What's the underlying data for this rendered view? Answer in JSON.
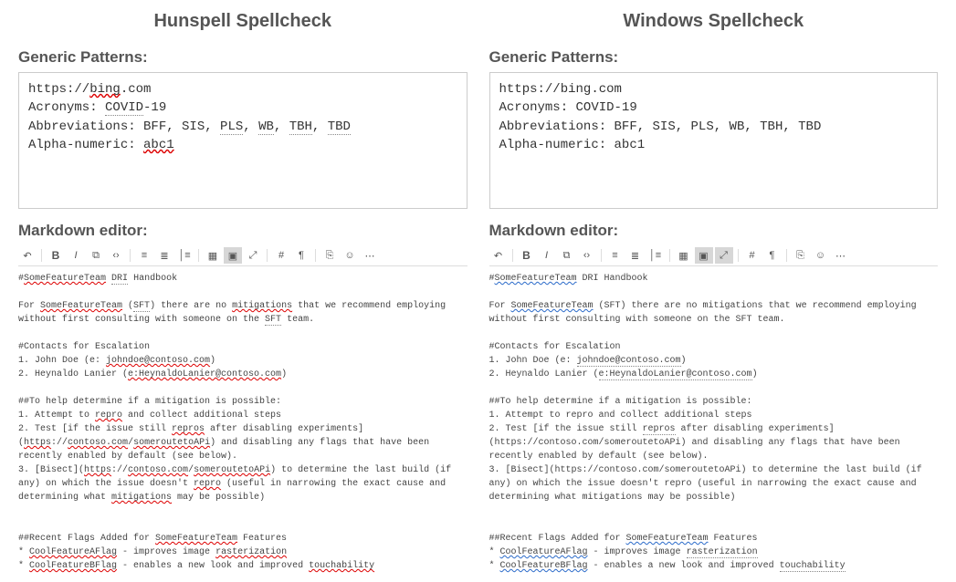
{
  "left": {
    "title": "Hunspell Spellcheck",
    "generic_title": "Generic Patterns:",
    "markdown_title": "Markdown editor:",
    "patterns": {
      "line1_pre": "https://",
      "line1_err": "bing",
      "line1_post": ".com",
      "line2_pre": "Acronyms: ",
      "line2_err": "COVID",
      "line2_post": "-19",
      "line3_pre": "Abbreviations: BFF, SIS, ",
      "pls": "PLS",
      "sep1": ", ",
      "wb": "WB",
      "sep2": ", ",
      "tbh": "TBH",
      "sep3": ", ",
      "tbd": "TBD",
      "line4_pre": "Alpha-numeric: ",
      "line4_err": "abc1"
    },
    "md": {
      "h1a": "#",
      "h1b": "SomeFeatureTeam",
      "h1c": " ",
      "h1d": "DRI",
      "h1e": " Handbook",
      "p1a": "For ",
      "p1b": "SomeFeatureTeam",
      "p1c": " (",
      "p1d": "SFT",
      "p1e": ") there are no ",
      "p1f": "mitigations",
      "p1g": " that we recommend employing without first consulting with someone on the ",
      "p1h": "SFT",
      "p1i": " team.",
      "c0": "#Contacts for Escalation",
      "c1a": "1. John Doe (e: ",
      "c1b": "johndoe@contoso.com",
      "c1c": ")",
      "c2a": "2. Heynaldo Lanier (",
      "c2b": "e:HeynaldoLanier@contoso.com",
      "c2c": ")",
      "m0": "##To help determine if a mitigation is possible:",
      "m1a": "1. Attempt to ",
      "m1b": "repro",
      "m1c": " and collect additional steps",
      "m2a": "2. Test [if the issue still ",
      "m2b": "repros",
      "m2c": " after disabling experiments](",
      "m2d": "https",
      "m2e": "://",
      "m2f": "contoso.com",
      "m2g": "/",
      "m2h": "someroutetoAPi",
      "m2i": ") and disabling any flags that have been recently enabled by default (see below).",
      "m3a": "3. [Bisect](",
      "m3b": "https",
      "m3c": "://",
      "m3d": "contoso.com",
      "m3e": "/",
      "m3f": "someroutetoAPi",
      "m3g": ") to determine the last build (if any) on which the issue doesn't ",
      "m3h": "repro",
      "m3i": " (useful in narrowing the exact cause and determining what ",
      "m3j": "mitigations",
      "m3k": " may be possible)",
      "f0a": "##Recent Flags Added for ",
      "f0b": "SomeFeatureTeam",
      "f0c": " Features",
      "f1a": "* ",
      "f1b": "CoolFeatureAFlag",
      "f1c": " - improves image ",
      "f1d": "rasterization",
      "f2a": "* ",
      "f2b": "CoolFeatureBFlag",
      "f2c": " - enables a new look and improved ",
      "f2d": "touchability"
    }
  },
  "right": {
    "title": "Windows Spellcheck",
    "generic_title": "Generic Patterns:",
    "markdown_title": "Markdown editor:",
    "patterns": {
      "line1": "https://bing.com",
      "line2": "Acronyms: COVID-19",
      "line3": "Abbreviations: BFF, SIS, PLS, WB, TBH, TBD",
      "line4": "Alpha-numeric: abc1"
    },
    "md": {
      "h1a": "#",
      "h1b": "SomeFeatureTeam",
      "h1c": " DRI Handbook",
      "p1a": "For ",
      "p1b": "SomeFeatureTeam",
      "p1c": " (SFT) there are no mitigations that we recommend employing without first consulting with someone on the SFT team.",
      "c0": "#Contacts for Escalation",
      "c1a": "1. John Doe (e: ",
      "c1b": "johndoe@contoso.com",
      "c1c": ")",
      "c2a": "2. Heynaldo Lanier (",
      "c2b": "e:HeynaldoLanier@contoso.com",
      "c2c": ")",
      "m0": "##To help determine if a mitigation is possible:",
      "m1": "1. Attempt to repro and collect additional steps",
      "m2a": "2. Test [if the issue still ",
      "m2b": "repros",
      "m2c": " after disabling experiments](https://contoso.com/someroutetoAPi) and disabling any flags that have been recently enabled by default (see below).",
      "m3": "3. [Bisect](https://contoso.com/someroutetoAPi) to determine the last build (if any) on which the issue doesn't repro (useful in narrowing the exact cause and determining what mitigations may be possible)",
      "f0a": "##Recent Flags Added for ",
      "f0b": "SomeFeatureTeam",
      "f0c": " Features",
      "f1a": "* ",
      "f1b": "CoolFeatureAFlag",
      "f1c": " - improves image ",
      "f1d": "rasterization",
      "f2a": "* ",
      "f2b": "CoolFeatureBFlag",
      "f2c": " - enables a new look and improved ",
      "f2d": "touchability"
    }
  },
  "toolbar": {
    "undo": "↶",
    "bold": "B",
    "italic": "I",
    "link": "⧉",
    "code": "‹›",
    "ol": "≡",
    "ul": "≣",
    "quote": "│≡",
    "table": "▦",
    "img": "▣",
    "expand": "⤢",
    "hash": "#",
    "attach": "¶",
    "copy": "⎘",
    "emoji": "☺",
    "more": "⋯"
  }
}
